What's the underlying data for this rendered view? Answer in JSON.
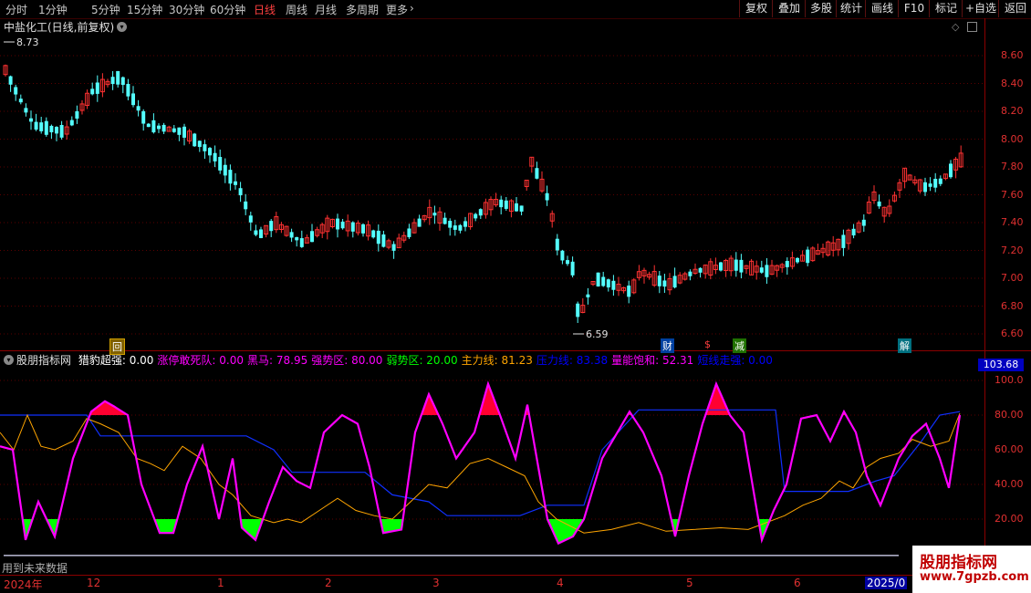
{
  "toolbar": {
    "periods": [
      "分时",
      "1分钟",
      "5分钟",
      "15分钟",
      "30分钟",
      "60分钟",
      "日线",
      "周线",
      "月线",
      "多周期",
      "更多"
    ],
    "active_period": "日线",
    "buttons": [
      "复权",
      "叠加",
      "多股",
      "统计",
      "画线",
      "F10",
      "标记",
      "+自选",
      "返回"
    ]
  },
  "main_chart": {
    "title": "中盐化工(日线,前复权)",
    "high_label": "8.73",
    "low_label": "6.59",
    "y_ticks": [
      "8.60",
      "8.40",
      "8.20",
      "8.00",
      "7.80",
      "7.60",
      "7.40",
      "7.20",
      "7.00",
      "6.80",
      "6.60"
    ],
    "markers": [
      "回",
      "财",
      "$",
      "减",
      "解"
    ],
    "colors": {
      "up": "#ff3232",
      "down": "#54ffff"
    }
  },
  "indicator": {
    "name": "股朋指标网",
    "legend": [
      {
        "label": "猎豹超强:",
        "value": "0.00",
        "color": "#ffffff"
      },
      {
        "label": "涨停敢死队:",
        "value": "0.00",
        "color": "#ff00ff"
      },
      {
        "label": "黑马:",
        "value": "78.95",
        "color": "#ff00ff"
      },
      {
        "label": "强势区:",
        "value": "80.00",
        "color": "#ff00ff"
      },
      {
        "label": "弱势区:",
        "value": "20.00",
        "color": "#00ff00"
      },
      {
        "label": "主力线:",
        "value": "81.23",
        "color": "#ffa500"
      },
      {
        "label": "压力线:",
        "value": "83.38",
        "color": "#0000ff"
      },
      {
        "label": "量能饱和:",
        "value": "52.31",
        "color": "#ff00ff"
      },
      {
        "label": "短线走强:",
        "value": "0.00",
        "color": "#0000ff"
      }
    ],
    "current_value": "103.68",
    "y_ticks": [
      "100.0",
      "80.00",
      "60.00",
      "40.00",
      "20.00"
    ],
    "footer_note": "用到未来数据"
  },
  "date_axis": {
    "labels": [
      "2024年",
      "12",
      "1",
      "2",
      "3",
      "4",
      "5",
      "6",
      "2025/0"
    ]
  },
  "watermark": {
    "line1": "股朋指标网",
    "line2": "www.7gpzb.com"
  }
}
